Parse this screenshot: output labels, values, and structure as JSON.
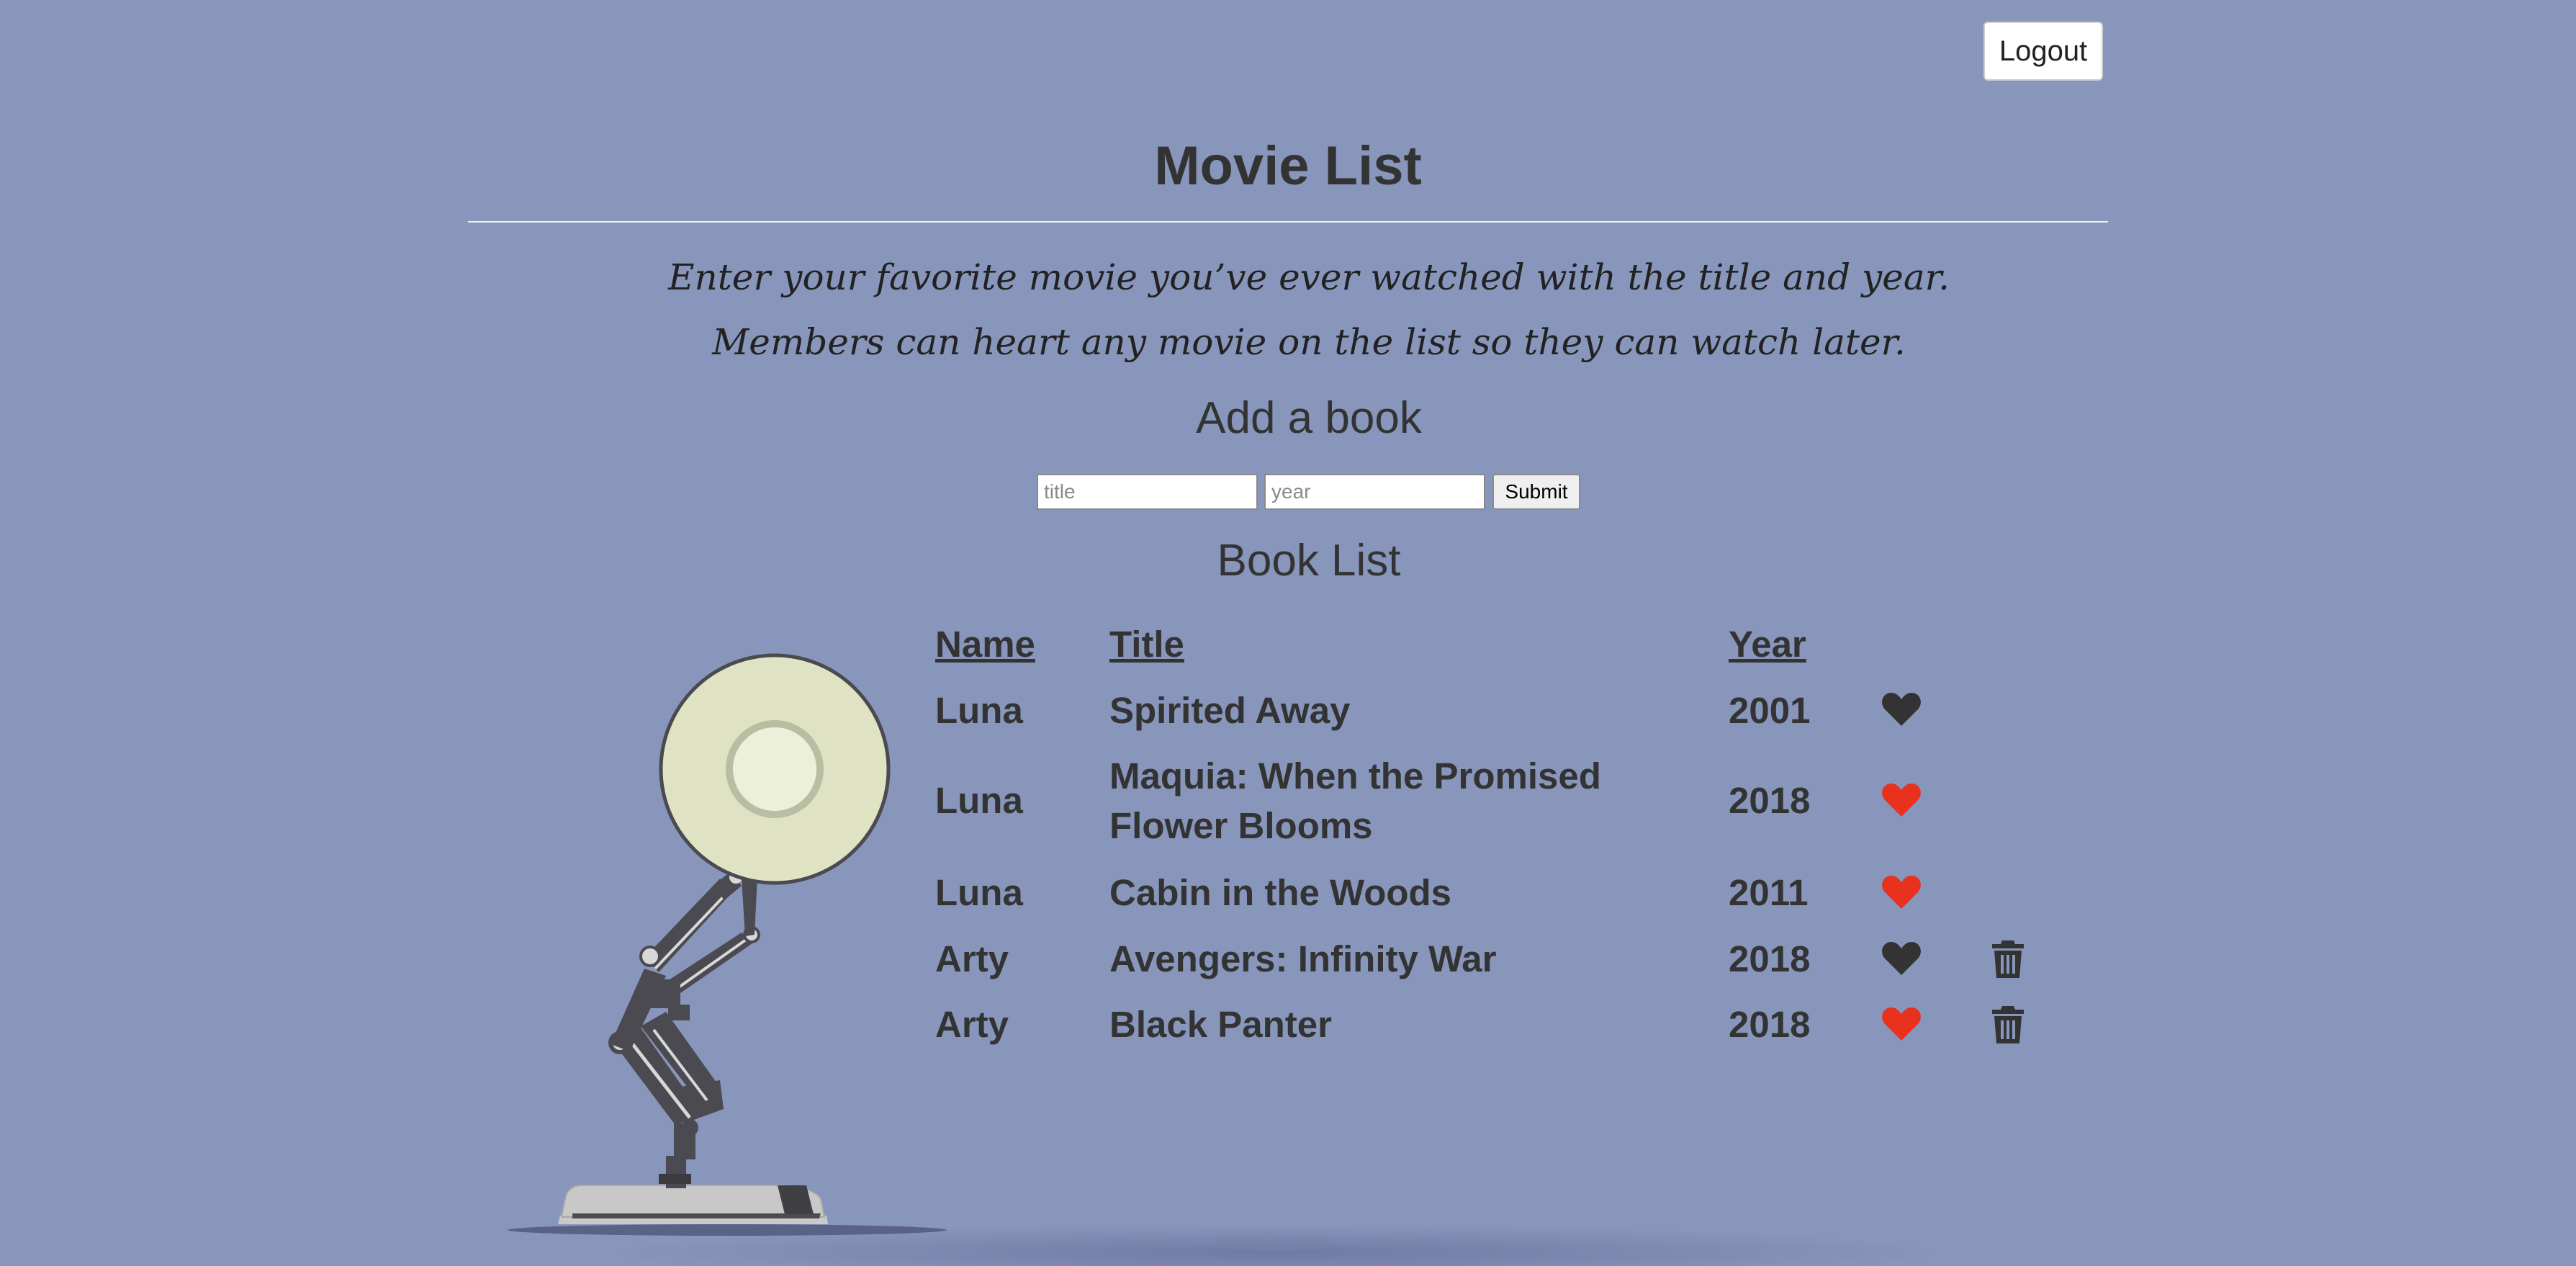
{
  "header": {
    "logout_label": "Logout"
  },
  "page": {
    "title": "Movie List",
    "intro_line1": "Enter your favorite movie you’ve ever watched with the title and year.",
    "intro_line2": "Members can heart any movie on the list so they can watch later."
  },
  "add_form": {
    "heading": "Add a book",
    "title_placeholder": "title",
    "year_placeholder": "year",
    "submit_label": "Submit"
  },
  "list": {
    "heading": "Book List",
    "columns": {
      "name": "Name",
      "title": "Title",
      "year": "Year"
    },
    "rows": [
      {
        "name": "Luna",
        "title": "Spirited Away",
        "year": "2001",
        "favorited": false,
        "deletable": false
      },
      {
        "name": "Luna",
        "title": "Maquia: When the Promised Flower Blooms",
        "year": "2018",
        "favorited": true,
        "deletable": false
      },
      {
        "name": "Luna",
        "title": "Cabin in the Woods",
        "year": "2011",
        "favorited": true,
        "deletable": false
      },
      {
        "name": "Arty",
        "title": "Avengers: Infinity War",
        "year": "2018",
        "favorited": false,
        "deletable": true
      },
      {
        "name": "Arty",
        "title": "Black Panter",
        "year": "2018",
        "favorited": true,
        "deletable": true
      }
    ]
  },
  "colors": {
    "background": "#8896bc",
    "heart_favorited": "#e8321e",
    "heart_default": "#333333",
    "text": "#333333"
  },
  "icons": {
    "heart": "heart-icon",
    "trash": "trash-icon",
    "lamp": "desk-lamp-illustration"
  }
}
